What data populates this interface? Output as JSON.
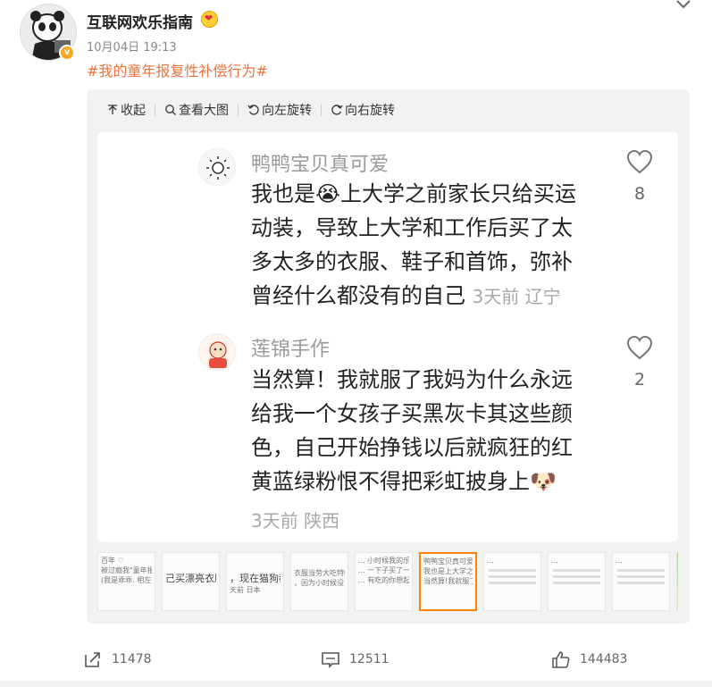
{
  "post": {
    "author": "互联网欢乐指南",
    "time": "10月04日 19:13",
    "hashtag": "#我的童年报复性补偿行为#"
  },
  "toolbar": {
    "collapse": "收起",
    "view_large": "查看大图",
    "rotate_left": "向左旋转",
    "rotate_right": "向右旋转"
  },
  "comments": [
    {
      "name": "鸭鸭宝贝真可爱",
      "text_lines": [
        "我也是😭上大学之前家长只给买运",
        "动装，导致上大学和工作后买了太",
        "多太多的衣服、鞋子和首饰，弥补",
        "曾经什么都没有的自己"
      ],
      "meta": "3天前 辽宁",
      "likes": "8"
    },
    {
      "name": "莲锦手作",
      "text_lines": [
        "当然算！我就服了我妈为什么永远",
        "给我一个女孩子买黑灰卡其这些颜",
        "色，自己开始挣钱以后就疯狂的红",
        "黄蓝绿粉恨不得把彩虹披身上🐶"
      ],
      "meta": "3天前 陕西",
      "likes": "2"
    }
  ],
  "thumbnails": [
    {
      "lines": [
        "百年 ♡",
        "被过瘾我\"童年报复性补",
        "(我是乖乖. 相左一些钱我"
      ]
    },
    {
      "lines": [
        "己买漂亮衣服算"
      ],
      "big": true
    },
    {
      "lines": [
        "，现在猫狗都",
        "天前 日本"
      ],
      "big": true
    },
    {
      "lines": [
        "衣服当劳大吃特吃,",
        "，因为小时候没去"
      ]
    },
    {
      "lines": [
        "... 小时候我的乐大百花团",
        "... 一下子买了一百多",
        "... 有吃的你想起来再"
      ]
    },
    {
      "lines": [
        "鸭鸭宝贝真可爱",
        "我也是上大学之前家长",
        "当然算!我就服了我妈"
      ],
      "active": true
    },
    {
      "lines": [
        "...",
        "...",
        "..."
      ]
    },
    {
      "lines": [
        "...",
        "...",
        "..."
      ]
    },
    {
      "lines": [
        "...",
        "...",
        "..."
      ]
    },
    {
      "lines": [
        ""
      ],
      "green": true
    }
  ],
  "actions": {
    "share_count": "11478",
    "comment_count": "12511",
    "like_count": "144483"
  },
  "colors": {
    "hashtag": "#eb7340",
    "active_thumb": "#ff8200"
  }
}
